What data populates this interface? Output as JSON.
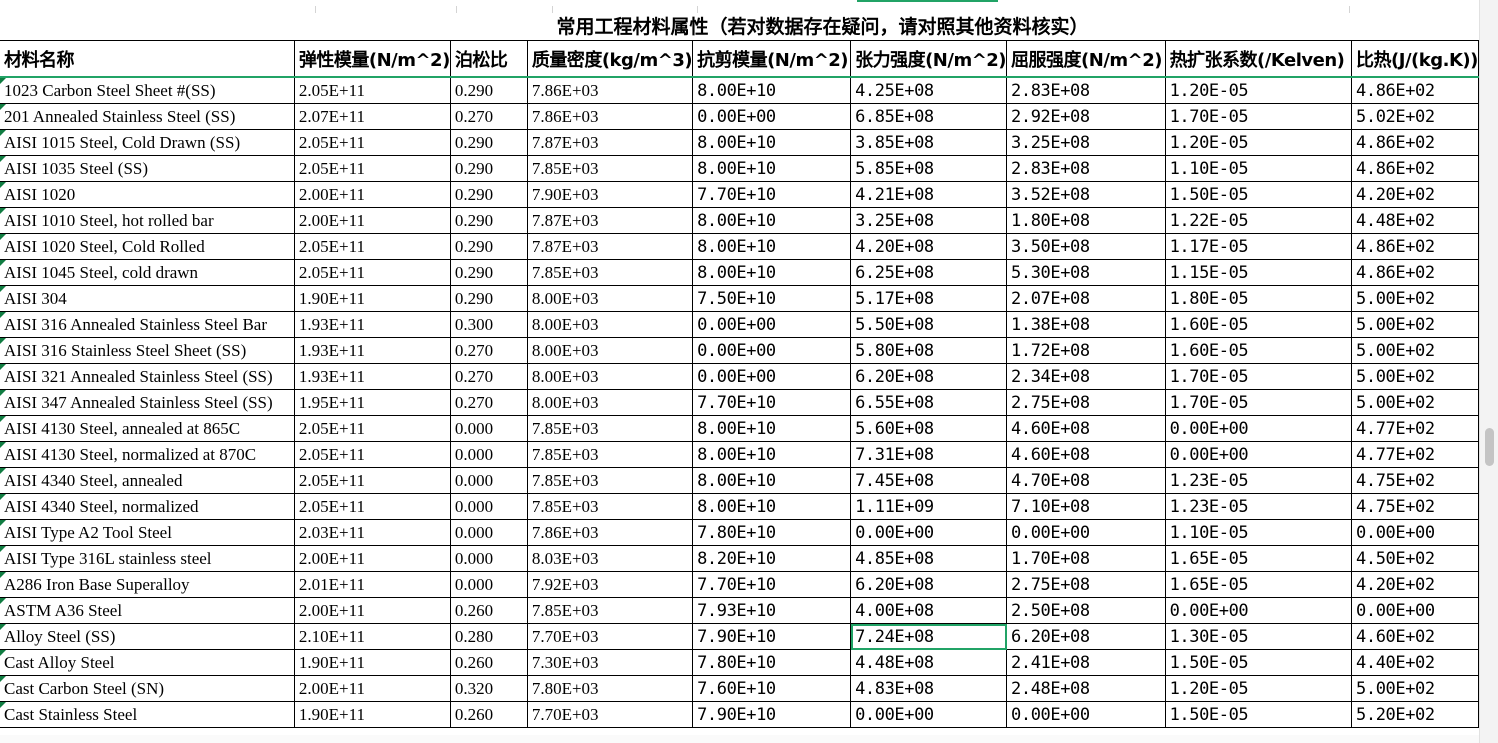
{
  "sheet": {
    "title": "常用工程材料属性（若对数据存在疑问，请对照其他资料核实）",
    "headers": [
      "材料名称",
      "弹性模量(N/m^2)",
      "泊松比",
      "质量密度(kg/m^3)",
      "抗剪模量(N/m^2)",
      "张力强度(N/m^2)",
      "屈服强度(N/m^2)",
      "热扩张系数(/Kelven)",
      "比热(J/(kg.K))"
    ],
    "rows": [
      [
        "1023 Carbon Steel Sheet #(SS)",
        "2.05E+11",
        "0.290",
        "7.86E+03",
        "8.00E+10",
        "4.25E+08",
        "2.83E+08",
        "1.20E-05",
        "4.86E+02"
      ],
      [
        "201 Annealed Stainless Steel (SS)",
        "2.07E+11",
        "0.270",
        "7.86E+03",
        "0.00E+00",
        "6.85E+08",
        "2.92E+08",
        "1.70E-05",
        "5.02E+02"
      ],
      [
        "AISI 1015 Steel, Cold Drawn (SS)",
        "2.05E+11",
        "0.290",
        "7.87E+03",
        "8.00E+10",
        "3.85E+08",
        "3.25E+08",
        "1.20E-05",
        "4.86E+02"
      ],
      [
        "AISI 1035 Steel (SS)",
        "2.05E+11",
        "0.290",
        "7.85E+03",
        "8.00E+10",
        "5.85E+08",
        "2.83E+08",
        "1.10E-05",
        "4.86E+02"
      ],
      [
        "AISI 1020",
        "2.00E+11",
        "0.290",
        "7.90E+03",
        "7.70E+10",
        "4.21E+08",
        "3.52E+08",
        "1.50E-05",
        "4.20E+02"
      ],
      [
        "AISI 1010 Steel, hot rolled bar",
        "2.00E+11",
        "0.290",
        "7.87E+03",
        "8.00E+10",
        "3.25E+08",
        "1.80E+08",
        "1.22E-05",
        "4.48E+02"
      ],
      [
        "AISI 1020 Steel, Cold Rolled",
        "2.05E+11",
        "0.290",
        "7.87E+03",
        "8.00E+10",
        "4.20E+08",
        "3.50E+08",
        "1.17E-05",
        "4.86E+02"
      ],
      [
        "AISI 1045 Steel, cold drawn",
        "2.05E+11",
        "0.290",
        "7.85E+03",
        "8.00E+10",
        "6.25E+08",
        "5.30E+08",
        "1.15E-05",
        "4.86E+02"
      ],
      [
        "AISI 304",
        "1.90E+11",
        "0.290",
        "8.00E+03",
        "7.50E+10",
        "5.17E+08",
        "2.07E+08",
        "1.80E-05",
        "5.00E+02"
      ],
      [
        "AISI 316 Annealed Stainless Steel Bar",
        "1.93E+11",
        "0.300",
        "8.00E+03",
        "0.00E+00",
        "5.50E+08",
        "1.38E+08",
        "1.60E-05",
        "5.00E+02"
      ],
      [
        "AISI 316 Stainless Steel Sheet (SS)",
        "1.93E+11",
        "0.270",
        "8.00E+03",
        "0.00E+00",
        "5.80E+08",
        "1.72E+08",
        "1.60E-05",
        "5.00E+02"
      ],
      [
        "AISI 321 Annealed Stainless Steel (SS)",
        "1.93E+11",
        "0.270",
        "8.00E+03",
        "0.00E+00",
        "6.20E+08",
        "2.34E+08",
        "1.70E-05",
        "5.00E+02"
      ],
      [
        "AISI 347 Annealed Stainless Steel (SS)",
        "1.95E+11",
        "0.270",
        "8.00E+03",
        "7.70E+10",
        "6.55E+08",
        "2.75E+08",
        "1.70E-05",
        "5.00E+02"
      ],
      [
        "AISI 4130 Steel, annealed at 865C",
        "2.05E+11",
        "0.000",
        "7.85E+03",
        "8.00E+10",
        "5.60E+08",
        "4.60E+08",
        "0.00E+00",
        "4.77E+02"
      ],
      [
        "AISI 4130 Steel, normalized at 870C",
        "2.05E+11",
        "0.000",
        "7.85E+03",
        "8.00E+10",
        "7.31E+08",
        "4.60E+08",
        "0.00E+00",
        "4.77E+02"
      ],
      [
        "AISI 4340 Steel, annealed",
        "2.05E+11",
        "0.000",
        "7.85E+03",
        "8.00E+10",
        "7.45E+08",
        "4.70E+08",
        "1.23E-05",
        "4.75E+02"
      ],
      [
        "AISI 4340 Steel, normalized",
        "2.05E+11",
        "0.000",
        "7.85E+03",
        "8.00E+10",
        "1.11E+09",
        "7.10E+08",
        "1.23E-05",
        "4.75E+02"
      ],
      [
        "AISI Type A2 Tool Steel",
        "2.03E+11",
        "0.000",
        "7.86E+03",
        "7.80E+10",
        "0.00E+00",
        "0.00E+00",
        "1.10E-05",
        "0.00E+00"
      ],
      [
        "AISI Type 316L stainless steel",
        "2.00E+11",
        "0.000",
        "8.03E+03",
        "8.20E+10",
        "4.85E+08",
        "1.70E+08",
        "1.65E-05",
        "4.50E+02"
      ],
      [
        "A286 Iron Base Superalloy",
        "2.01E+11",
        "0.000",
        "7.92E+03",
        "7.70E+10",
        "6.20E+08",
        "2.75E+08",
        "1.65E-05",
        "4.20E+02"
      ],
      [
        "ASTM A36 Steel",
        "2.00E+11",
        "0.260",
        "7.85E+03",
        "7.93E+10",
        "4.00E+08",
        "2.50E+08",
        "0.00E+00",
        "0.00E+00"
      ],
      [
        "Alloy Steel (SS)",
        "2.10E+11",
        "0.280",
        "7.70E+03",
        "7.90E+10",
        "7.24E+08",
        "6.20E+08",
        "1.30E-05",
        "4.60E+02"
      ],
      [
        "Cast Alloy Steel",
        "1.90E+11",
        "0.260",
        "7.30E+03",
        "7.80E+10",
        "4.48E+08",
        "2.41E+08",
        "1.50E-05",
        "4.40E+02"
      ],
      [
        "Cast Carbon Steel (SN)",
        "2.00E+11",
        "0.320",
        "7.80E+03",
        "7.60E+10",
        "4.83E+08",
        "2.48E+08",
        "1.20E-05",
        "5.00E+02"
      ],
      [
        "Cast Stainless Steel",
        "1.90E+11",
        "0.260",
        "7.70E+03",
        "7.90E+10",
        "0.00E+00",
        "0.00E+00",
        "1.50E-05",
        "5.20E+02"
      ]
    ],
    "selected_cell": {
      "row": 21,
      "col": 5
    }
  }
}
